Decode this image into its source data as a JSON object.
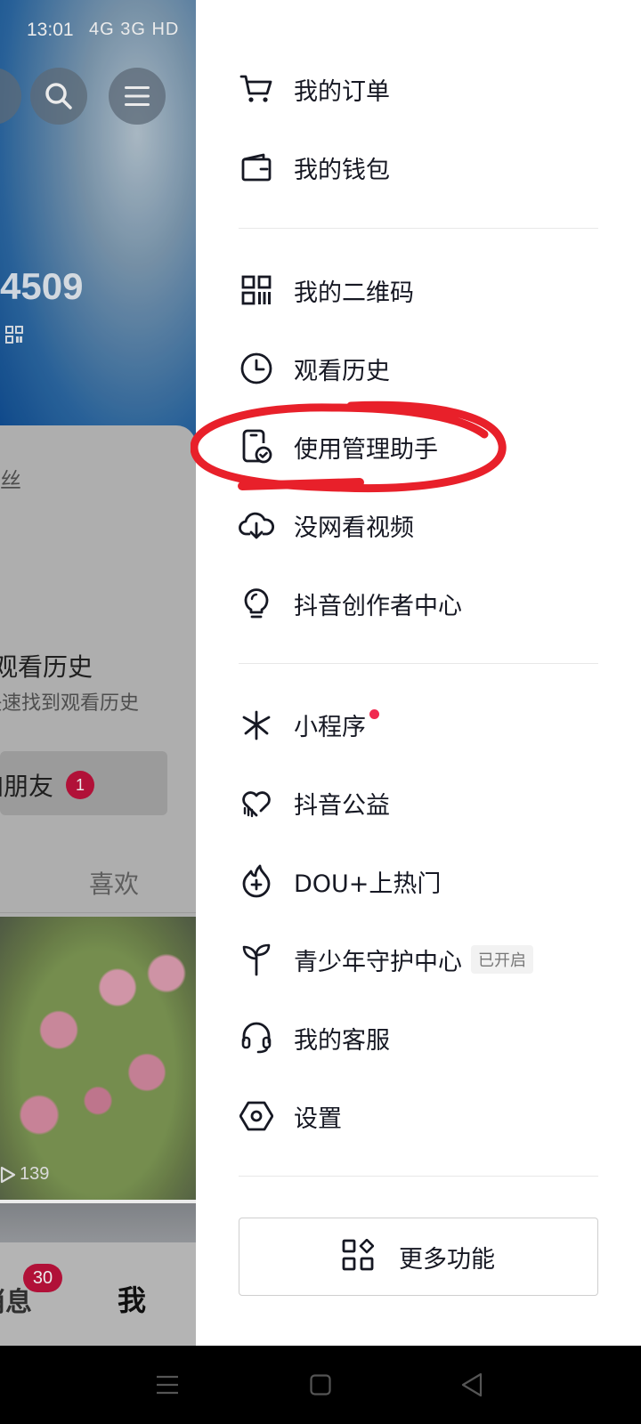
{
  "status_bar": {
    "time": "13:01",
    "network": "4G 3G HD"
  },
  "background": {
    "user_number_fragment": "4509",
    "fans_fragment": "丝",
    "history_card": {
      "title": "观看历史",
      "subtitle": "快速找到观看历史"
    },
    "friends_button": {
      "label": "加朋友",
      "badge": "1"
    },
    "likes_tab": "喜欢",
    "video_views": "139",
    "bottom_nav": {
      "messages_label": "消息",
      "messages_badge": "30",
      "me_label": "我"
    }
  },
  "drawer": {
    "items": [
      {
        "label": "我的订单",
        "icon": "cart-icon"
      },
      {
        "label": "我的钱包",
        "icon": "wallet-icon"
      },
      {
        "label": "我的二维码",
        "icon": "qr-code-icon"
      },
      {
        "label": "观看历史",
        "icon": "clock-icon"
      },
      {
        "label": "使用管理助手",
        "icon": "phone-check-icon"
      },
      {
        "label": "没网看视频",
        "icon": "cloud-download-icon"
      },
      {
        "label": "抖音创作者中心",
        "icon": "lightbulb-icon"
      },
      {
        "label": "小程序",
        "icon": "mini-program-icon",
        "has_dot": true
      },
      {
        "label": "抖音公益",
        "icon": "heart-hand-icon"
      },
      {
        "label": "DOU+上热门",
        "icon": "fire-plus-icon"
      },
      {
        "label": "青少年守护中心",
        "icon": "sprout-icon",
        "tag": "已开启"
      },
      {
        "label": "我的客服",
        "icon": "headset-icon"
      },
      {
        "label": "设置",
        "icon": "settings-icon"
      }
    ],
    "more_button": {
      "label": "更多功能",
      "icon": "grid-icon"
    }
  },
  "colors": {
    "accent_red": "#f0294f",
    "badge_red": "#c0133d",
    "annotation_red": "#e8202a"
  }
}
